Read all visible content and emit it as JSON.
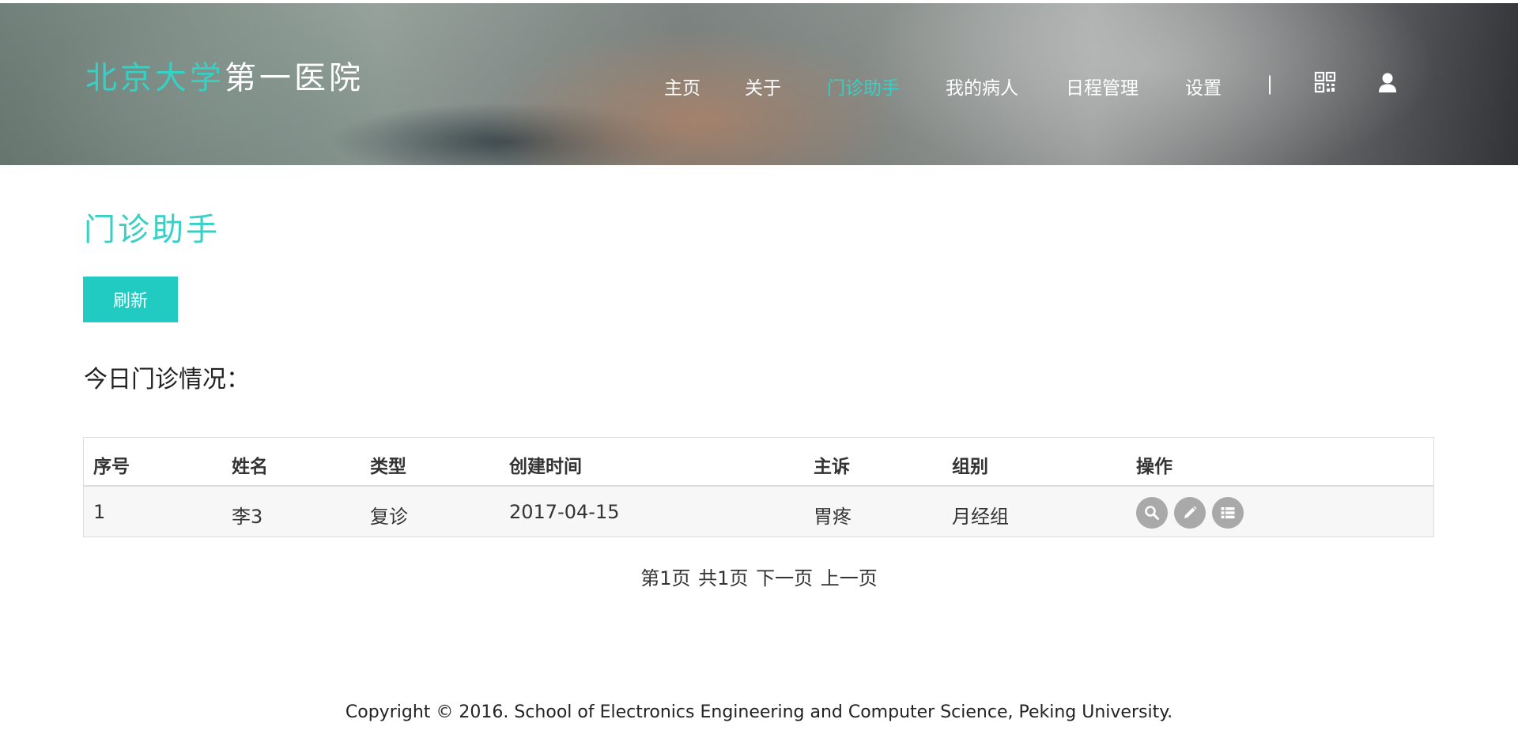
{
  "header": {
    "logo_accent": "北京大学",
    "logo_white": "第一医院",
    "nav": {
      "home": "主页",
      "about": "关于",
      "clinic_assistant": "门诊助手",
      "my_patients": "我的病人",
      "schedule": "日程管理",
      "settings": "设置",
      "separator": "|"
    },
    "icons": [
      "qrcode-icon",
      "user-icon"
    ],
    "accent_color": "#35d1c5"
  },
  "page": {
    "title": "门诊助手",
    "refresh_label": "刷新",
    "section_heading": "今日门诊情况："
  },
  "table": {
    "columns": [
      "序号",
      "姓名",
      "类型",
      "创建时间",
      "主诉",
      "组别",
      "操作"
    ],
    "rows": [
      {
        "index": "1",
        "name": "李3",
        "type": "复诊",
        "created": "2017-04-15",
        "complaint": "胃疼",
        "group": "月经组",
        "actions": [
          "search-icon",
          "edit-icon",
          "list-icon"
        ]
      }
    ]
  },
  "pagination": {
    "current": "第1页",
    "total": "共1页",
    "next": "下一页",
    "prev": "上一页"
  },
  "footer": {
    "copyright": "Copyright © 2016. School of Electronics Engineering and Computer Science, Peking University."
  }
}
